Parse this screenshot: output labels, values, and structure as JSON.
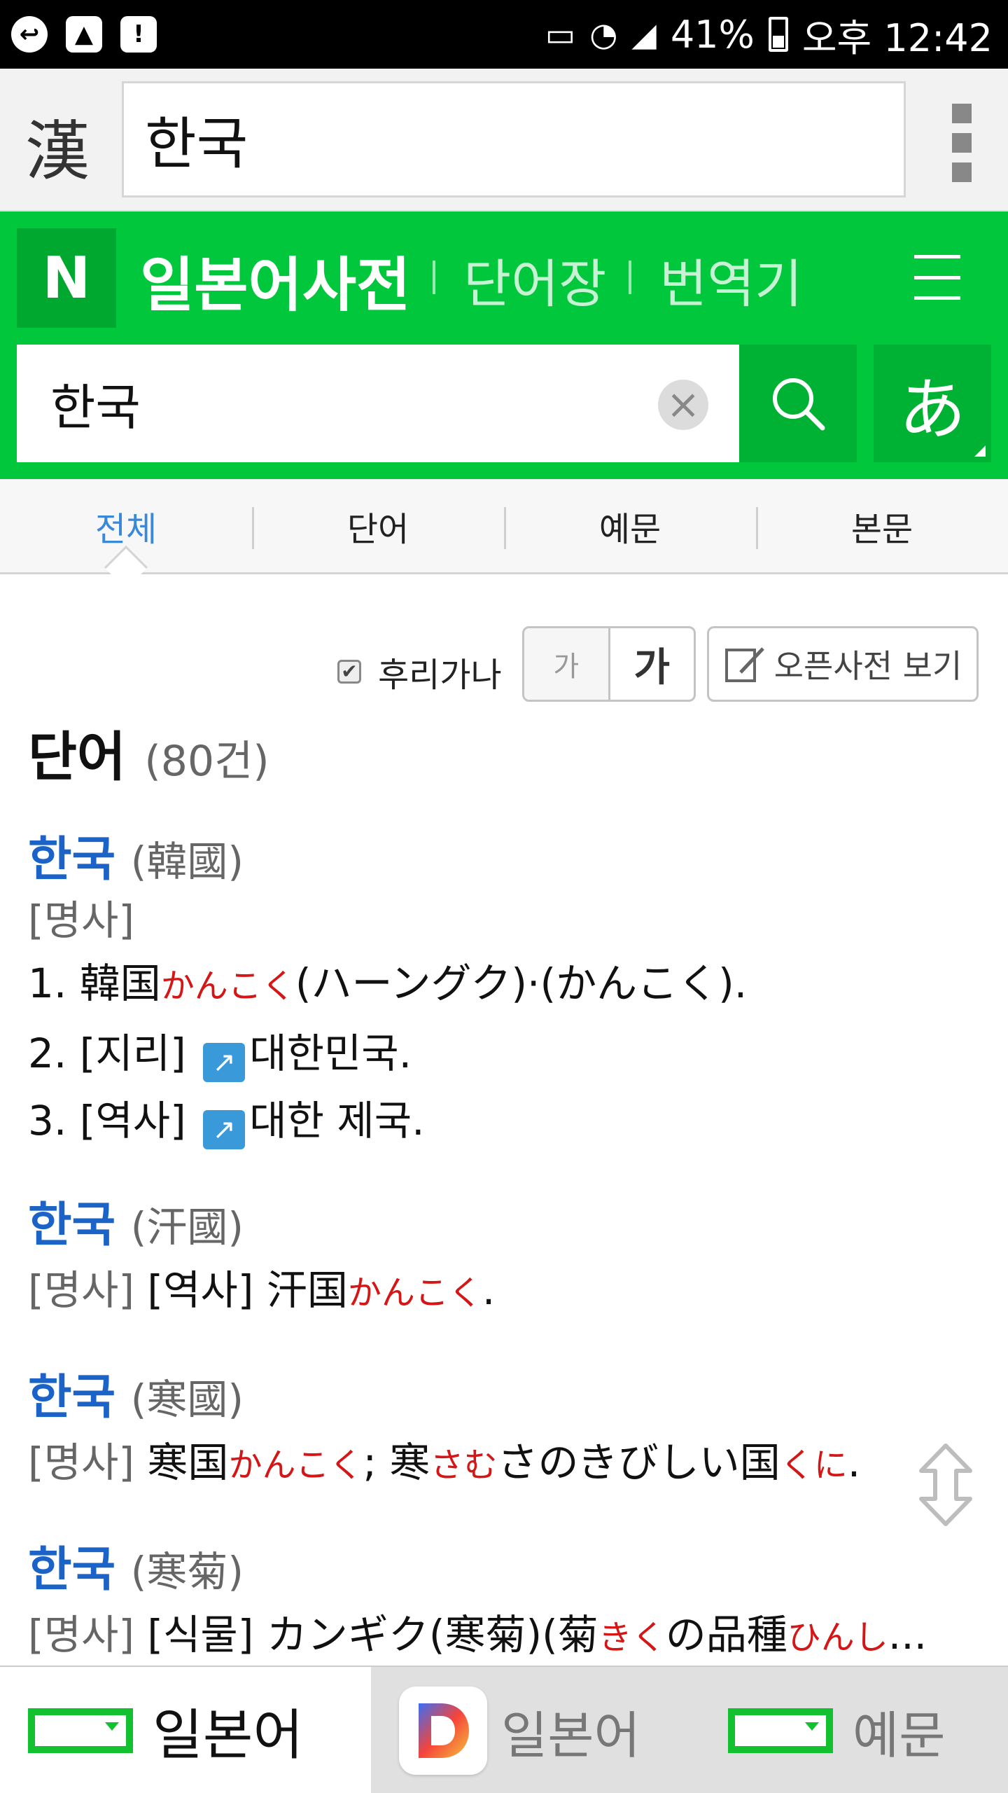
{
  "status_bar": {
    "battery": "41%",
    "time": "오후 12:42",
    "left_icons": [
      "app-icon",
      "image-icon",
      "alert-icon"
    ],
    "right_icons": [
      "cast-icon",
      "wifi-icon",
      "signal-icon",
      "battery-icon"
    ]
  },
  "top_bar": {
    "hanja_button": "漢",
    "query": "한국",
    "menu_icon": "more-vertical-icon"
  },
  "header": {
    "logo": "N",
    "title": "일본어사전",
    "links": [
      "단어장",
      "번역기"
    ],
    "menu_icon": "hamburger-icon",
    "search_value": "한국",
    "kana_button": "あ",
    "accent": "#00c73c"
  },
  "tabs": [
    {
      "label": "전체",
      "active": true
    },
    {
      "label": "단어",
      "active": false
    },
    {
      "label": "예문",
      "active": false
    },
    {
      "label": "본문",
      "active": false
    }
  ],
  "options": {
    "furigana_label": "후리가나",
    "furigana_checked": true,
    "font_small": "가",
    "font_large": "가",
    "open_dict": "오픈사전 보기"
  },
  "results": {
    "section_title": "단어",
    "count": "(80건)",
    "entries": [
      {
        "headword": "한국",
        "origin": "(韓國)",
        "pos": "[명사]",
        "defs": [
          {
            "num": "1.",
            "text": "韓国",
            "reading": "かんこく",
            "rest": "(ハーングク)·(かんこく)."
          },
          {
            "num": "2.",
            "tag": "[지리]",
            "text": "대한민국."
          },
          {
            "num": "3.",
            "tag": "[역사]",
            "text": "대한 제국."
          }
        ]
      },
      {
        "headword": "한국",
        "origin": "(汗國)",
        "pos": "[명사]",
        "tag": "[역사]",
        "text": "汗国",
        "reading": "かんこく",
        "rest": "."
      },
      {
        "headword": "한국",
        "origin": "(寒國)",
        "pos": "[명사]",
        "text": "寒国",
        "reading": "かんこく",
        "mid": "; 寒",
        "reading2": "さむ",
        "mid2": "さのきびしい国",
        "reading3": "くに",
        "rest": "."
      },
      {
        "headword": "한국",
        "origin": "(寒菊)",
        "pos": "[명사]",
        "tag": "[식물]",
        "text": "カンギク(寒菊)(菊",
        "reading": "きく",
        "mid": "の品種",
        "reading2": "ひんし",
        "rest": "..."
      }
    ]
  },
  "bottom_bar": {
    "tabs": [
      {
        "label": "일본어",
        "icon": "naver-dict-icon",
        "active": true
      },
      {
        "label": "일본어",
        "icon": "daum-d-icon",
        "active": false
      },
      {
        "label": "예문",
        "icon": "naver-dict-icon",
        "active": false
      }
    ]
  }
}
